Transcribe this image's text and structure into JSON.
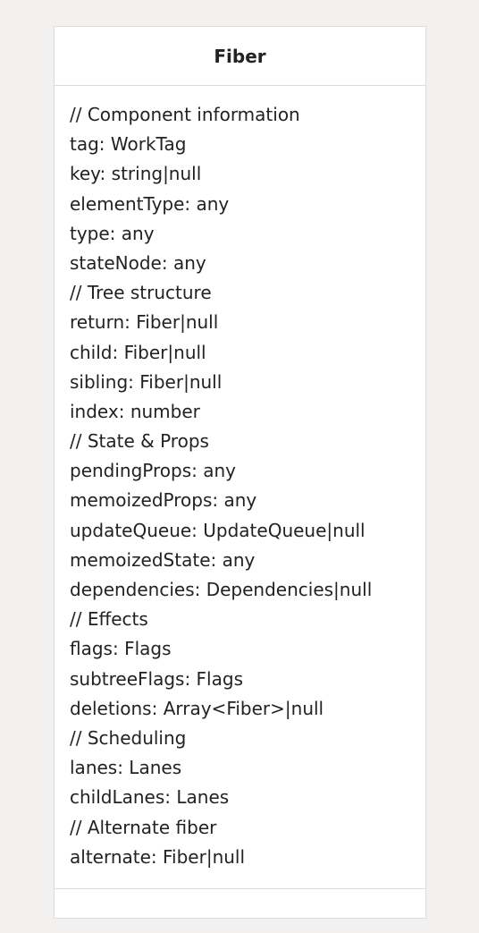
{
  "class": {
    "title": "Fiber",
    "members": [
      "// Component information",
      "tag: WorkTag",
      "key: string|null",
      "elementType: any",
      "type: any",
      "stateNode: any",
      "// Tree structure",
      "return: Fiber|null",
      "child: Fiber|null",
      "sibling: Fiber|null",
      "index: number",
      "// State & Props",
      "pendingProps: any",
      "memoizedProps: any",
      "updateQueue: UpdateQueue|null",
      "memoizedState: any",
      "dependencies: Dependencies|null",
      "// Effects",
      "flags: Flags",
      "subtreeFlags: Flags",
      "deletions: Array<Fiber>|null",
      "// Scheduling",
      "lanes: Lanes",
      "childLanes: Lanes",
      "// Alternate fiber",
      "alternate: Fiber|null"
    ],
    "methods": []
  }
}
